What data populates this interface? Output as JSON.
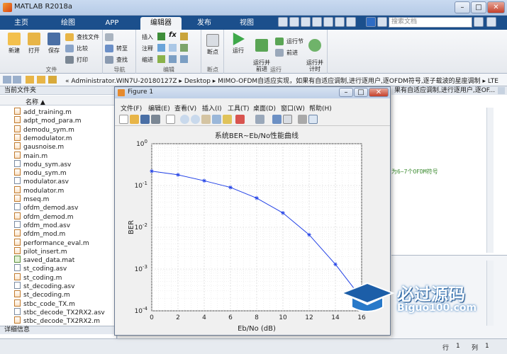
{
  "window": {
    "title": "MATLAB R2018a"
  },
  "tabs": [
    {
      "label": "主页"
    },
    {
      "label": "绘图"
    },
    {
      "label": "APP"
    },
    {
      "label": "编辑器"
    },
    {
      "label": "发布"
    },
    {
      "label": "视图"
    }
  ],
  "search": {
    "placeholder": "搜索文档"
  },
  "ribbon": {
    "file": {
      "new": "新建",
      "open": "打开",
      "save": "保存",
      "find_files": "查找文件",
      "compare": "比较",
      "print": "打印",
      "group": "文件"
    },
    "nav": {
      "goto": "转至",
      "find": "查找",
      "group": "导航"
    },
    "edit": {
      "insert": "插入",
      "comment": "注释",
      "indent": "缩进",
      "fx": "fx",
      "group": "编辑"
    },
    "breakpoint": {
      "breakpoints": "断点",
      "group": "断点"
    },
    "run": {
      "run": "运行",
      "run_advance": "运行并\n前进",
      "run_section": "运行节",
      "advance": "前进",
      "run_time": "运行并\n计时",
      "group": "运行"
    }
  },
  "address": {
    "path": "« Administrator.WIN7U-20180127Z  ▸  Desktop  ▸  MIMO-OFDM自适应实现，如果有自适应调制,进行逐用户,逐OFDM符号,逐子载波的星座调制  ▸  LTE"
  },
  "left_panel": {
    "title": "当前文件夹",
    "col_name": "名称 ▲",
    "files": [
      {
        "name": "add_training.m",
        "kind": "m"
      },
      {
        "name": "adpt_mod_para.m",
        "kind": "m"
      },
      {
        "name": "demodu_sym.m",
        "kind": "m"
      },
      {
        "name": "demodulator.m",
        "kind": "m"
      },
      {
        "name": "gausnoise.m",
        "kind": "m"
      },
      {
        "name": "main.m",
        "kind": "m"
      },
      {
        "name": "modu_sym.asv",
        "kind": "asv"
      },
      {
        "name": "modu_sym.m",
        "kind": "m"
      },
      {
        "name": "modulator.asv",
        "kind": "asv"
      },
      {
        "name": "modulator.m",
        "kind": "m"
      },
      {
        "name": "mseq.m",
        "kind": "m"
      },
      {
        "name": "ofdm_demod.asv",
        "kind": "asv"
      },
      {
        "name": "ofdm_demod.m",
        "kind": "m"
      },
      {
        "name": "ofdm_mod.asv",
        "kind": "asv"
      },
      {
        "name": "ofdm_mod.m",
        "kind": "m"
      },
      {
        "name": "performance_eval.m",
        "kind": "m"
      },
      {
        "name": "pilot_insert.m",
        "kind": "m"
      },
      {
        "name": "saved_data.mat",
        "kind": "mat"
      },
      {
        "name": "st_coding.asv",
        "kind": "asv"
      },
      {
        "name": "st_coding.m",
        "kind": "m"
      },
      {
        "name": "st_decoding.asv",
        "kind": "asv"
      },
      {
        "name": "st_decoding.m",
        "kind": "m"
      },
      {
        "name": "stbc_code_TX.m",
        "kind": "m"
      },
      {
        "name": "stbc_decode_TX2RX2.asv",
        "kind": "asv"
      },
      {
        "name": "stbc_decode_TX2RX2.m",
        "kind": "m"
      }
    ],
    "details": "详细信息"
  },
  "right_panel": {
    "header": "果有自适应调制,进行逐用户,逐OF...",
    "code_line": "为6~7个OFDM符号"
  },
  "status": {
    "row_label": "行",
    "row": "1",
    "col_label": "列",
    "col": "1"
  },
  "figure": {
    "title": "Figure 1",
    "menu": [
      "文件(F)",
      "编辑(E)",
      "查看(V)",
      "插入(I)",
      "工具(T)",
      "桌面(D)",
      "窗口(W)",
      "帮助(H)"
    ]
  },
  "chart_data": {
    "type": "line",
    "title": "系统BER~Eb/No性能曲线",
    "xlabel": "Eb/No (dB)",
    "ylabel": "BER",
    "xlim": [
      0,
      16
    ],
    "ylim": [
      0.0001,
      1
    ],
    "yscale": "log",
    "grid": true,
    "x_ticks": [
      "0",
      "2",
      "4",
      "6",
      "8",
      "10",
      "12",
      "14",
      "16"
    ],
    "y_ticks": [
      "10^0",
      "10^-1",
      "10^-2",
      "10^-3",
      "10^-4"
    ],
    "series": [
      {
        "color": "#1f3fe6",
        "marker": "*",
        "x": [
          0,
          2,
          4,
          6,
          8,
          10,
          12,
          14,
          16
        ],
        "y": [
          0.22,
          0.18,
          0.13,
          0.09,
          0.05,
          0.022,
          0.0066,
          0.0013,
          0.0002
        ]
      }
    ]
  },
  "watermark": {
    "brand": "必过源码",
    "site": "Biguo100.com"
  }
}
